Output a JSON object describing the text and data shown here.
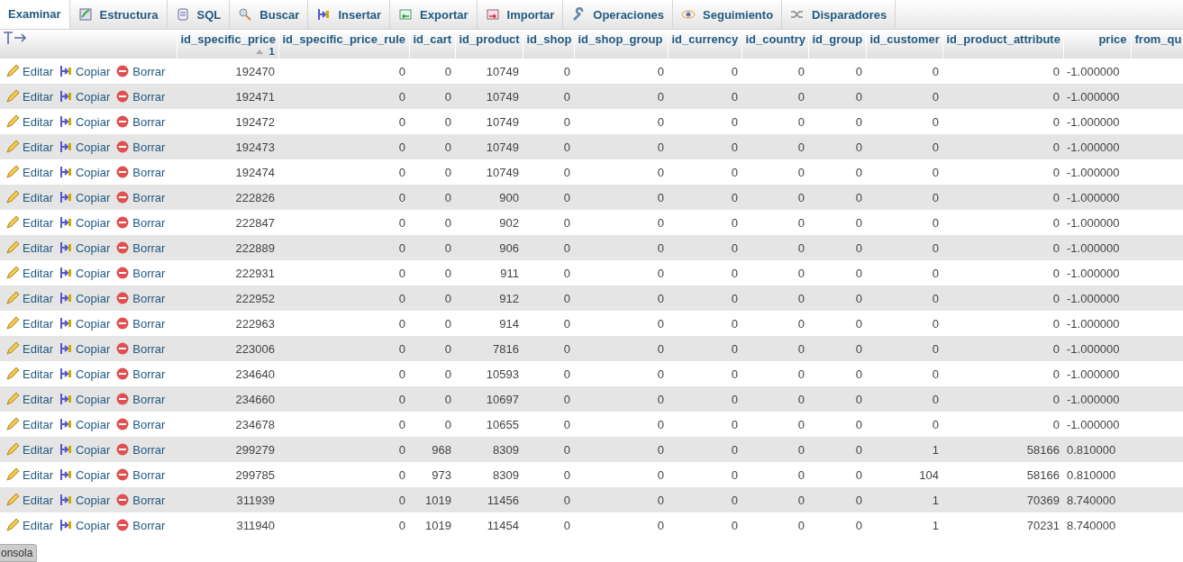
{
  "tabs": [
    {
      "label": "Examinar",
      "selected": true
    },
    {
      "label": "Estructura",
      "selected": false
    },
    {
      "label": "SQL",
      "selected": false
    },
    {
      "label": "Buscar",
      "selected": false
    },
    {
      "label": "Insertar",
      "selected": false
    },
    {
      "label": "Exportar",
      "selected": false
    },
    {
      "label": "Importar",
      "selected": false
    },
    {
      "label": "Operaciones",
      "selected": false
    },
    {
      "label": "Seguimiento",
      "selected": false
    },
    {
      "label": "Disparadores",
      "selected": false
    }
  ],
  "table": {
    "columns": [
      {
        "label": "id_specific_price",
        "sort_order": "1"
      },
      {
        "label": "id_specific_price_rule"
      },
      {
        "label": "id_cart"
      },
      {
        "label": "id_product"
      },
      {
        "label": "id_shop"
      },
      {
        "label": "id_shop_group"
      },
      {
        "label": "id_currency"
      },
      {
        "label": "id_country"
      },
      {
        "label": "id_group"
      },
      {
        "label": "id_customer"
      },
      {
        "label": "id_product_attribute"
      },
      {
        "label": "price"
      },
      {
        "label": "from_qu"
      }
    ],
    "rows": [
      {
        "actions": [
          "Editar",
          "Copiar",
          "Borrar"
        ],
        "cells": [
          "192470",
          "0",
          "0",
          "10749",
          "0",
          "0",
          "0",
          "0",
          "0",
          "0",
          "0",
          "-1.000000"
        ]
      },
      {
        "actions": [
          "Editar",
          "Copiar",
          "Borrar"
        ],
        "cells": [
          "192471",
          "0",
          "0",
          "10749",
          "0",
          "0",
          "0",
          "0",
          "0",
          "0",
          "0",
          "-1.000000"
        ]
      },
      {
        "actions": [
          "Editar",
          "Copiar",
          "Borrar"
        ],
        "cells": [
          "192472",
          "0",
          "0",
          "10749",
          "0",
          "0",
          "0",
          "0",
          "0",
          "0",
          "0",
          "-1.000000"
        ]
      },
      {
        "actions": [
          "Editar",
          "Copiar",
          "Borrar"
        ],
        "cells": [
          "192473",
          "0",
          "0",
          "10749",
          "0",
          "0",
          "0",
          "0",
          "0",
          "0",
          "0",
          "-1.000000"
        ]
      },
      {
        "actions": [
          "Editar",
          "Copiar",
          "Borrar"
        ],
        "cells": [
          "192474",
          "0",
          "0",
          "10749",
          "0",
          "0",
          "0",
          "0",
          "0",
          "0",
          "0",
          "-1.000000"
        ]
      },
      {
        "actions": [
          "Editar",
          "Copiar",
          "Borrar"
        ],
        "cells": [
          "222826",
          "0",
          "0",
          "900",
          "0",
          "0",
          "0",
          "0",
          "0",
          "0",
          "0",
          "-1.000000"
        ]
      },
      {
        "actions": [
          "Editar",
          "Copiar",
          "Borrar"
        ],
        "cells": [
          "222847",
          "0",
          "0",
          "902",
          "0",
          "0",
          "0",
          "0",
          "0",
          "0",
          "0",
          "-1.000000"
        ]
      },
      {
        "actions": [
          "Editar",
          "Copiar",
          "Borrar"
        ],
        "cells": [
          "222889",
          "0",
          "0",
          "906",
          "0",
          "0",
          "0",
          "0",
          "0",
          "0",
          "0",
          "-1.000000"
        ]
      },
      {
        "actions": [
          "Editar",
          "Copiar",
          "Borrar"
        ],
        "cells": [
          "222931",
          "0",
          "0",
          "911",
          "0",
          "0",
          "0",
          "0",
          "0",
          "0",
          "0",
          "-1.000000"
        ]
      },
      {
        "actions": [
          "Editar",
          "Copiar",
          "Borrar"
        ],
        "cells": [
          "222952",
          "0",
          "0",
          "912",
          "0",
          "0",
          "0",
          "0",
          "0",
          "0",
          "0",
          "-1.000000"
        ]
      },
      {
        "actions": [
          "Editar",
          "Copiar",
          "Borrar"
        ],
        "cells": [
          "222963",
          "0",
          "0",
          "914",
          "0",
          "0",
          "0",
          "0",
          "0",
          "0",
          "0",
          "-1.000000"
        ]
      },
      {
        "actions": [
          "Editar",
          "Copiar",
          "Borrar"
        ],
        "cells": [
          "223006",
          "0",
          "0",
          "7816",
          "0",
          "0",
          "0",
          "0",
          "0",
          "0",
          "0",
          "-1.000000"
        ]
      },
      {
        "actions": [
          "Editar",
          "Copiar",
          "Borrar"
        ],
        "cells": [
          "234640",
          "0",
          "0",
          "10593",
          "0",
          "0",
          "0",
          "0",
          "0",
          "0",
          "0",
          "-1.000000"
        ]
      },
      {
        "actions": [
          "Editar",
          "Copiar",
          "Borrar"
        ],
        "cells": [
          "234660",
          "0",
          "0",
          "10697",
          "0",
          "0",
          "0",
          "0",
          "0",
          "0",
          "0",
          "-1.000000"
        ]
      },
      {
        "actions": [
          "Editar",
          "Copiar",
          "Borrar"
        ],
        "cells": [
          "234678",
          "0",
          "0",
          "10655",
          "0",
          "0",
          "0",
          "0",
          "0",
          "0",
          "0",
          "-1.000000"
        ]
      },
      {
        "actions": [
          "Editar",
          "Copiar",
          "Borrar"
        ],
        "cells": [
          "299279",
          "0",
          "968",
          "8309",
          "0",
          "0",
          "0",
          "0",
          "0",
          "1",
          "58166",
          "0.810000"
        ]
      },
      {
        "actions": [
          "Editar",
          "Copiar",
          "Borrar"
        ],
        "cells": [
          "299785",
          "0",
          "973",
          "8309",
          "0",
          "0",
          "0",
          "0",
          "0",
          "104",
          "58166",
          "0.810000"
        ]
      },
      {
        "actions": [
          "Editar",
          "Copiar",
          "Borrar"
        ],
        "cells": [
          "311939",
          "0",
          "1019",
          "11456",
          "0",
          "0",
          "0",
          "0",
          "0",
          "1",
          "70369",
          "8.740000"
        ]
      },
      {
        "actions": [
          "Editar",
          "Copiar",
          "Borrar"
        ],
        "cells": [
          "311940",
          "0",
          "1019",
          "11454",
          "0",
          "0",
          "0",
          "0",
          "0",
          "1",
          "70231",
          "8.740000"
        ]
      }
    ]
  },
  "console_tab": {
    "label": "onsola"
  }
}
